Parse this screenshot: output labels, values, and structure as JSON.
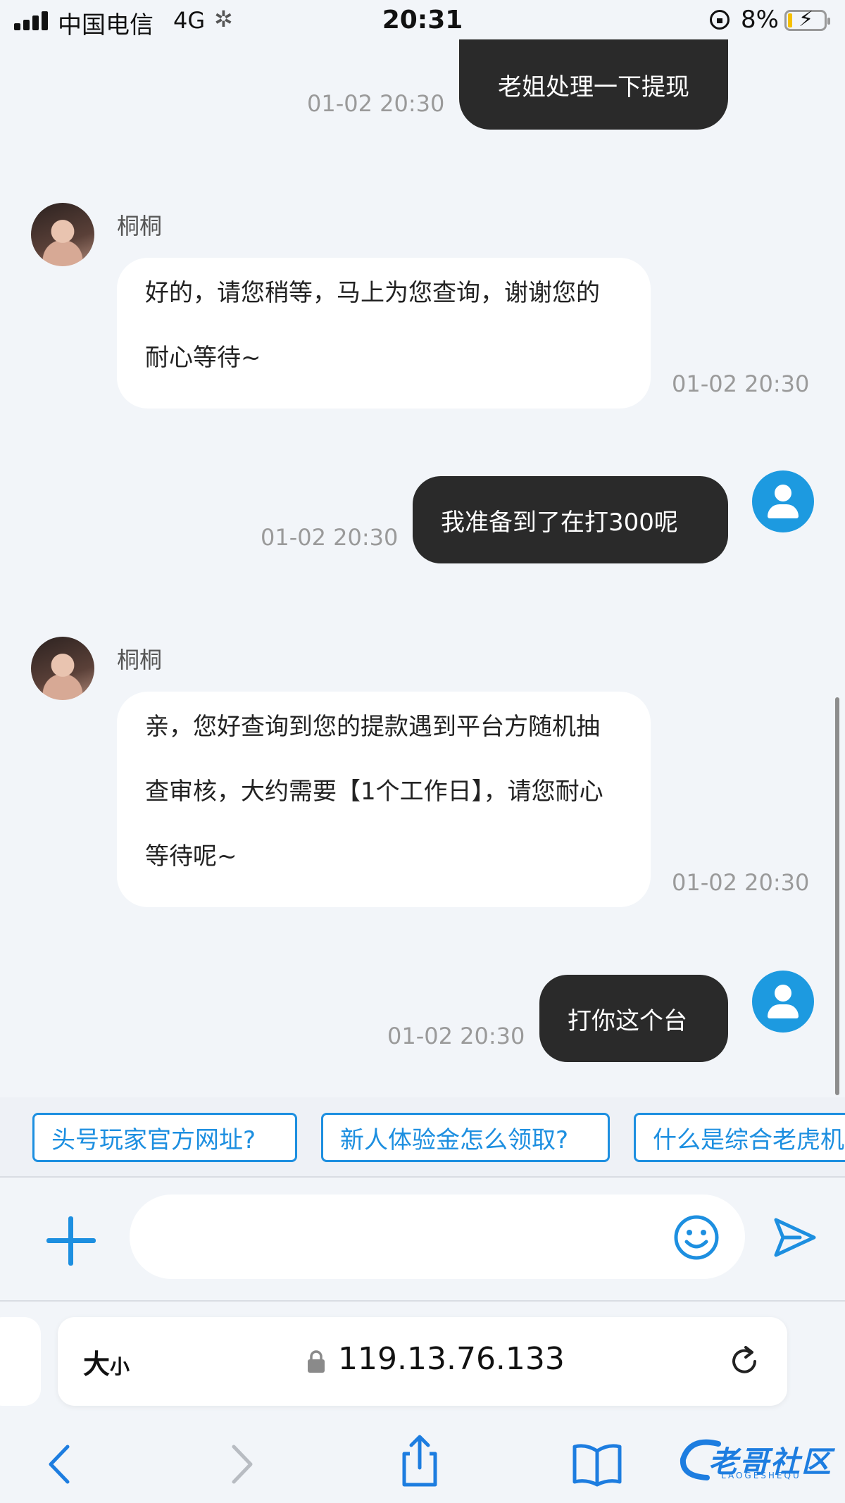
{
  "status_bar": {
    "carrier": "中国电信",
    "network": "4G",
    "time": "20:31",
    "battery_percent": "8%"
  },
  "messages": [
    {
      "direction": "out",
      "text": "老姐处理一下提现",
      "timestamp": "01-02 20:30"
    },
    {
      "direction": "in",
      "sender": "桐桐",
      "text": "好的，请您稍等，马上为您查询，谢谢您的耐心等待~",
      "timestamp": "01-02 20:30"
    },
    {
      "direction": "out",
      "text": "我准备到了在打300呢",
      "timestamp": "01-02 20:30"
    },
    {
      "direction": "in",
      "sender": "桐桐",
      "text": "亲，您好查询到您的提款遇到平台方随机抽查审核，大约需要【1个工作日】，请您耐心等待呢~",
      "timestamp": "01-02 20:30"
    },
    {
      "direction": "out",
      "text": "打你这个台",
      "timestamp": "01-02 20:30"
    }
  ],
  "quick_replies": [
    "头号玩家官方网址?",
    "新人体验金怎么领取?",
    "什么是综合老虎机"
  ],
  "input": {
    "placeholder": "",
    "value": ""
  },
  "browser": {
    "text_size_label": "大",
    "text_size_small": "小",
    "url": "119.13.76.133"
  },
  "watermark": {
    "text": "老哥社区",
    "subtext": "LAOGESHEQU"
  },
  "icons": [
    "plus-icon",
    "emoji-icon",
    "send-icon",
    "lock-icon",
    "reload-icon",
    "back-icon",
    "forward-icon",
    "share-icon",
    "bookmarks-icon",
    "tabs-icon"
  ],
  "colors": {
    "accent": "#1d8fe0",
    "bubble_out": "#2a2a2a",
    "bubble_in": "#ffffff",
    "background": "#f2f5f9"
  }
}
